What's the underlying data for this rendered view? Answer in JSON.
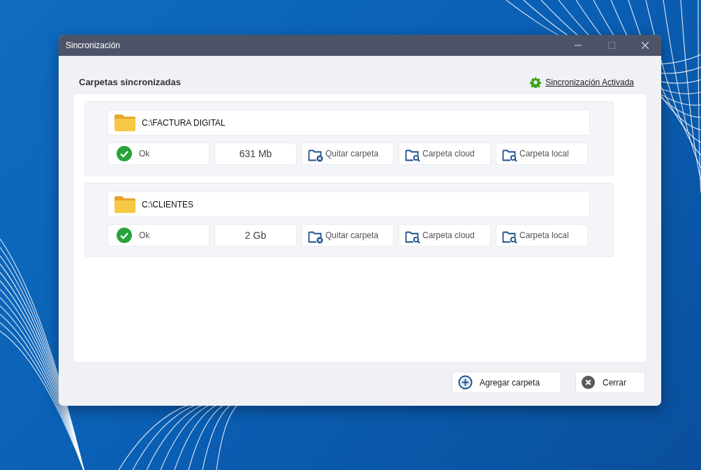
{
  "window": {
    "title": "Sincronización"
  },
  "header": {
    "title": "Carpetas sincronizadas",
    "sync_link": "Sincronización Activada"
  },
  "folders": [
    {
      "path": "C:\\FACTURA DIGITAL",
      "status": {
        "kind": "ok",
        "label": "Ok"
      },
      "size": "631 Mb",
      "actions": [
        {
          "kind": "remove",
          "label": "Quitar carpeta"
        },
        {
          "kind": "search",
          "label": "Carpeta cloud"
        },
        {
          "kind": "search",
          "label": "Carpeta local"
        }
      ]
    },
    {
      "path": "C:\\CLIENTES",
      "status": {
        "kind": "ok",
        "label": "Ok"
      },
      "size": "2 Gb",
      "actions": [
        {
          "kind": "remove",
          "label": "Quitar carpeta"
        },
        {
          "kind": "search",
          "label": "Carpeta cloud"
        },
        {
          "kind": "search",
          "label": "Carpeta local"
        }
      ]
    }
  ],
  "footer": {
    "buttons": [
      {
        "kind": "add",
        "label": "Agregar carpeta"
      },
      {
        "kind": "close",
        "label": "Cerrar"
      }
    ]
  }
}
